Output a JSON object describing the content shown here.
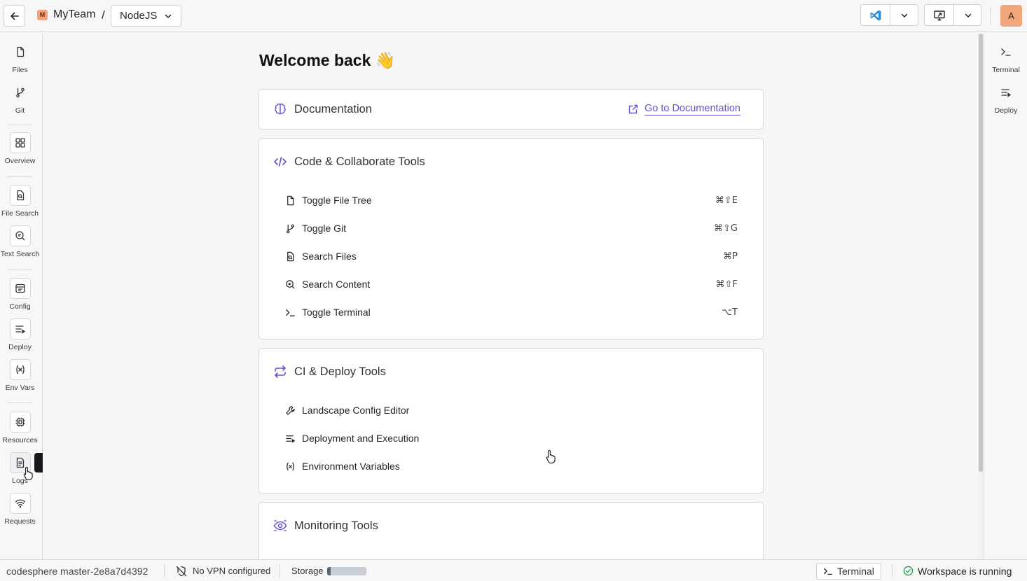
{
  "topbar": {
    "team_initial": "M",
    "team_name": "MyTeam",
    "separator": "/",
    "project": "NodeJS",
    "avatar_initial": "A"
  },
  "left_nav": [
    {
      "label": "Files",
      "icon": "file-icon"
    },
    {
      "label": "Git",
      "icon": "git-branch-icon"
    },
    {
      "label": "Overview",
      "icon": "grid-icon"
    },
    {
      "label": "File Search",
      "icon": "file-search-icon"
    },
    {
      "label": "Text Search",
      "icon": "text-search-icon"
    },
    {
      "label": "Config",
      "icon": "config-icon"
    },
    {
      "label": "Deploy",
      "icon": "deploy-icon"
    },
    {
      "label": "Env Vars",
      "icon": "variable-icon"
    },
    {
      "label": "Resources",
      "icon": "chip-icon"
    },
    {
      "label": "Logs",
      "icon": "logs-icon"
    },
    {
      "label": "Requests",
      "icon": "wifi-icon"
    }
  ],
  "tooltip": "Logs",
  "right_nav": [
    {
      "label": "Terminal",
      "icon": "terminal-icon"
    },
    {
      "label": "Deploy",
      "icon": "deploy-icon"
    }
  ],
  "main": {
    "welcome": "Welcome back 👋",
    "documentation": {
      "title": "Documentation",
      "link": "Go to Documentation"
    },
    "code_tools": {
      "title": "Code & Collaborate Tools",
      "items": [
        {
          "label": "Toggle File Tree",
          "shortcut": "⌘⇧E",
          "icon": "file-icon"
        },
        {
          "label": "Toggle Git",
          "shortcut": "⌘⇧G",
          "icon": "git-branch-icon"
        },
        {
          "label": "Search Files",
          "shortcut": "⌘P",
          "icon": "file-search-icon"
        },
        {
          "label": "Search Content",
          "shortcut": "⌘⇧F",
          "icon": "text-search-icon"
        },
        {
          "label": "Toggle Terminal",
          "shortcut": "⌥T",
          "icon": "terminal-icon"
        }
      ]
    },
    "ci_tools": {
      "title": "CI & Deploy Tools",
      "items": [
        {
          "label": "Landscape Config Editor",
          "icon": "wrench-icon"
        },
        {
          "label": "Deployment and Execution",
          "icon": "deploy-icon"
        },
        {
          "label": "Environment Variables",
          "icon": "variable-icon"
        }
      ]
    },
    "monitoring": {
      "title": "Monitoring Tools"
    }
  },
  "statusbar": {
    "branch": "codesphere master-2e8a7d4392",
    "vpn": "No VPN configured",
    "storage_label": "Storage",
    "storage_fraction": 0.1,
    "terminal": "Terminal",
    "workspace_status": "Workspace is running"
  },
  "colors": {
    "accent": "#6b4fd3",
    "avatar": "#f2a67e",
    "running": "#1e9e4a"
  }
}
